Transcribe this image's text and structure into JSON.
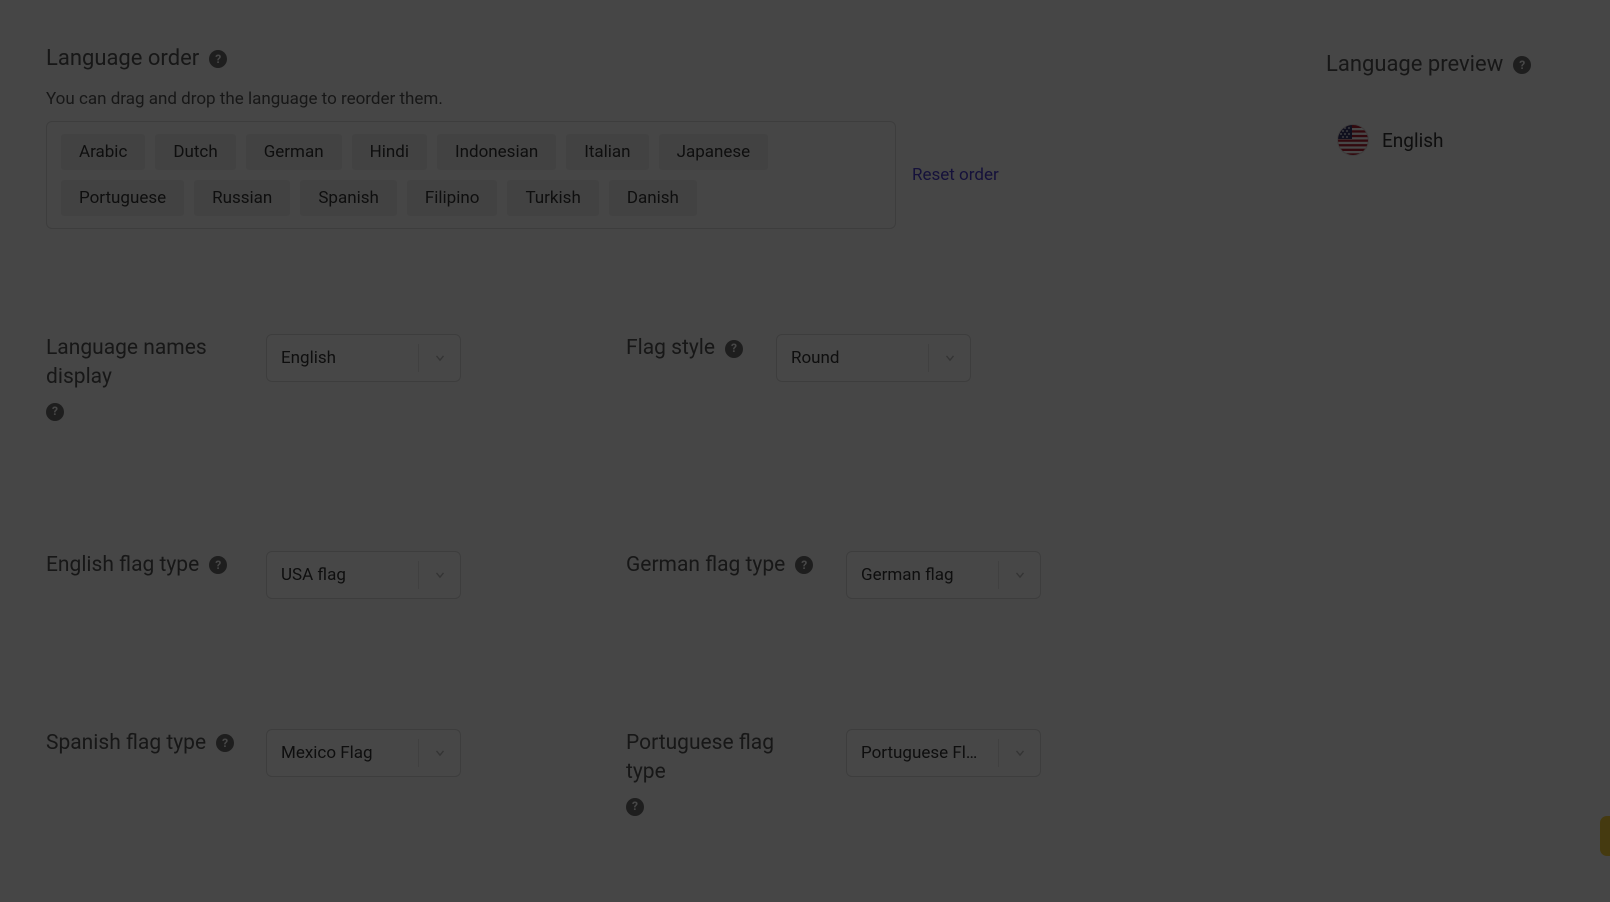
{
  "language_order": {
    "title": "Language order",
    "hint": "You can drag and drop the language to reorder them.",
    "items": [
      "Arabic",
      "Dutch",
      "German",
      "Hindi",
      "Indonesian",
      "Italian",
      "Japanese",
      "Portuguese",
      "Russian",
      "Spanish",
      "Filipino",
      "Turkish",
      "Danish"
    ],
    "reset_label": "Reset order"
  },
  "settings": {
    "names_display": {
      "label": "Language names display",
      "value": "English"
    },
    "flag_style": {
      "label": "Flag style",
      "value": "Round"
    },
    "english_flag": {
      "label": "English flag type",
      "value": "USA flag"
    },
    "german_flag": {
      "label": "German flag type",
      "value": "German flag"
    },
    "spanish_flag": {
      "label": "Spanish flag type",
      "value": "Mexico Flag"
    },
    "portuguese_flag": {
      "label": "Portuguese flag type",
      "value": "Portuguese Fl…"
    }
  },
  "preview": {
    "title": "Language preview",
    "item_label": "English"
  }
}
